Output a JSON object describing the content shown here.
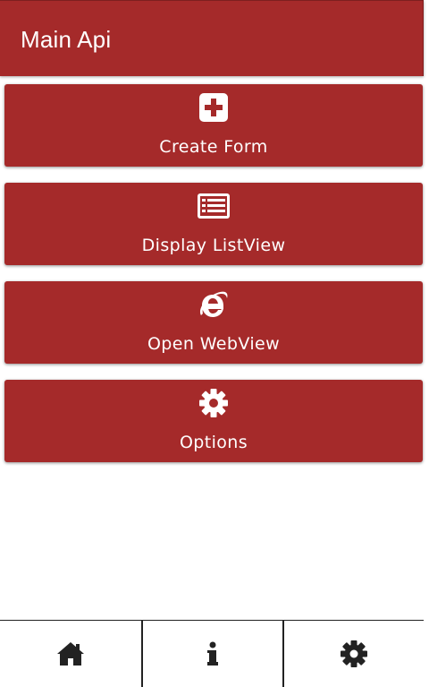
{
  "app_bar": {
    "title": "Main Api",
    "color": "#a52a2a"
  },
  "menu": {
    "items": [
      {
        "label": "Create Form",
        "icon": "plus-square-icon"
      },
      {
        "label": "Display ListView",
        "icon": "list-icon"
      },
      {
        "label": "Open WebView",
        "icon": "internet-explorer-icon"
      },
      {
        "label": "Options",
        "icon": "gear-icon"
      }
    ]
  },
  "bottom_nav": {
    "tabs": [
      {
        "icon": "home-icon"
      },
      {
        "icon": "info-icon"
      },
      {
        "icon": "gear-icon"
      }
    ]
  }
}
